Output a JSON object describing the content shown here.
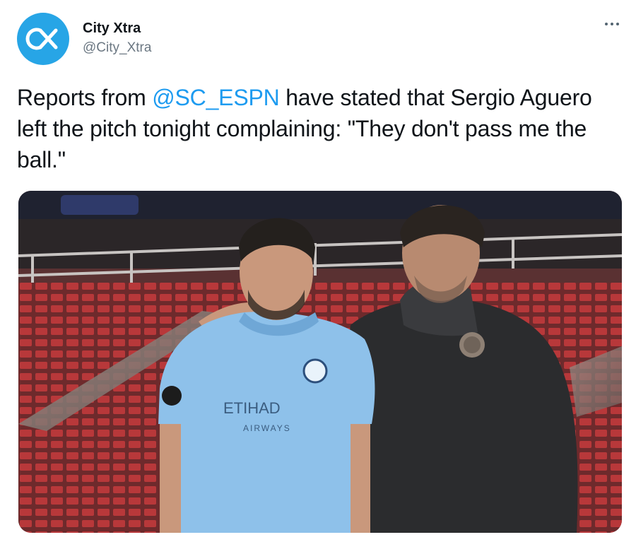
{
  "account": {
    "display_name": "City Xtra",
    "handle": "@City_Xtra",
    "avatar_icon": "city-xtra-logo-icon",
    "avatar_color": "#27a5e6"
  },
  "tweet": {
    "text_before": "Reports from ",
    "mention": "@SC_ESPN",
    "text_after": " have stated that Sergio Aguero left the pitch tonight complaining: \"They don't pass me the ball.\"",
    "mention_color": "#1d9bf0"
  },
  "media": {
    "jersey_sponsor": "ETIHAD",
    "jersey_sponsor_sub": "AIRWAYS"
  },
  "menu_icon": "more-dots-icon"
}
